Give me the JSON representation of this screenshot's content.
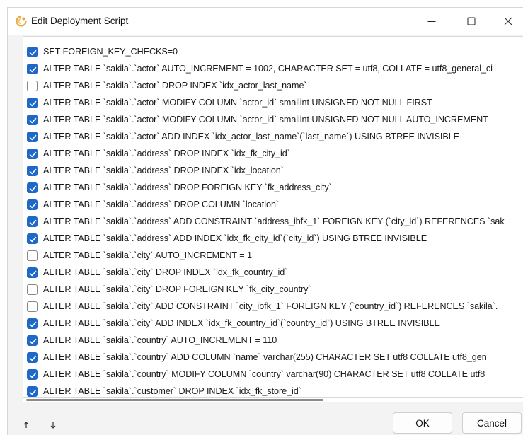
{
  "window": {
    "title": "Edit Deployment Script"
  },
  "items": [
    {
      "label": "SET FOREIGN_KEY_CHECKS=0",
      "checked": true
    },
    {
      "label": "ALTER TABLE `sakila`.`actor` AUTO_INCREMENT = 1002, CHARACTER SET = utf8, COLLATE = utf8_general_ci",
      "checked": true
    },
    {
      "label": "ALTER TABLE `sakila`.`actor` DROP INDEX `idx_actor_last_name`",
      "checked": false
    },
    {
      "label": "ALTER TABLE `sakila`.`actor` MODIFY COLUMN `actor_id` smallint UNSIGNED NOT NULL FIRST",
      "checked": true
    },
    {
      "label": "ALTER TABLE `sakila`.`actor` MODIFY COLUMN `actor_id` smallint UNSIGNED NOT NULL AUTO_INCREMENT",
      "checked": true
    },
    {
      "label": "ALTER TABLE `sakila`.`actor` ADD INDEX `idx_actor_last_name`(`last_name`) USING BTREE INVISIBLE",
      "checked": true
    },
    {
      "label": "ALTER TABLE `sakila`.`address` DROP INDEX `idx_fk_city_id`",
      "checked": true
    },
    {
      "label": "ALTER TABLE `sakila`.`address` DROP INDEX `idx_location`",
      "checked": true
    },
    {
      "label": "ALTER TABLE `sakila`.`address` DROP FOREIGN KEY `fk_address_city`",
      "checked": true
    },
    {
      "label": "ALTER TABLE `sakila`.`address` DROP COLUMN `location`",
      "checked": true
    },
    {
      "label": "ALTER TABLE `sakila`.`address` ADD CONSTRAINT `address_ibfk_1` FOREIGN KEY (`city_id`) REFERENCES `sak",
      "checked": true
    },
    {
      "label": "ALTER TABLE `sakila`.`address` ADD INDEX `idx_fk_city_id`(`city_id`) USING BTREE INVISIBLE",
      "checked": true
    },
    {
      "label": "ALTER TABLE `sakila`.`city` AUTO_INCREMENT = 1",
      "checked": false
    },
    {
      "label": "ALTER TABLE `sakila`.`city` DROP INDEX `idx_fk_country_id`",
      "checked": true
    },
    {
      "label": "ALTER TABLE `sakila`.`city` DROP FOREIGN KEY `fk_city_country`",
      "checked": false
    },
    {
      "label": "ALTER TABLE `sakila`.`city` ADD CONSTRAINT `city_ibfk_1` FOREIGN KEY (`country_id`) REFERENCES `sakila`.",
      "checked": false
    },
    {
      "label": "ALTER TABLE `sakila`.`city` ADD INDEX `idx_fk_country_id`(`country_id`) USING BTREE INVISIBLE",
      "checked": true
    },
    {
      "label": "ALTER TABLE `sakila`.`country` AUTO_INCREMENT = 110",
      "checked": true
    },
    {
      "label": "ALTER TABLE `sakila`.`country` ADD COLUMN `name` varchar(255) CHARACTER SET utf8 COLLATE utf8_gen",
      "checked": true
    },
    {
      "label": "ALTER TABLE `sakila`.`country` MODIFY COLUMN `country` varchar(90) CHARACTER SET utf8 COLLATE utf8",
      "checked": true
    },
    {
      "label": "ALTER TABLE `sakila`.`customer` DROP INDEX `idx_fk_store_id`",
      "checked": true
    }
  ],
  "footer": {
    "move_up_icon": "arrow-up",
    "move_down_icon": "arrow-down",
    "ok_label": "OK",
    "cancel_label": "Cancel"
  },
  "colors": {
    "checkbox_checked": "#1e68c8",
    "window_bg": "#f3f3f3"
  }
}
